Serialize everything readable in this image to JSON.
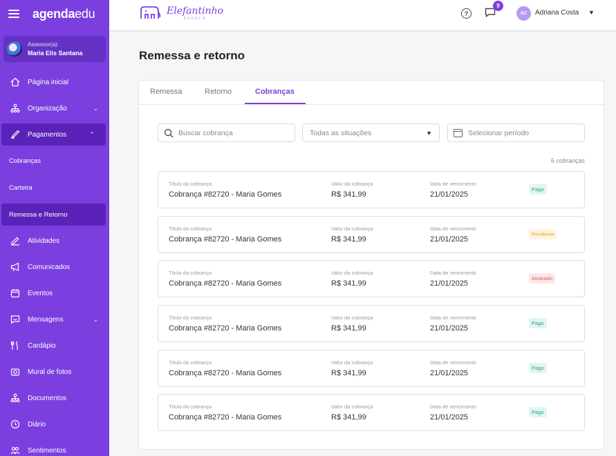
{
  "sidebar": {
    "brand_bold": "agenda",
    "brand_light": "edu",
    "assessor": {
      "role": "Assessor(a):",
      "name": "Maria Elis Santana"
    },
    "items": {
      "home": "Página inicial",
      "org": "Organização",
      "payments": "Pagamentos",
      "charges": "Cobranças",
      "wallet": "Carteira",
      "remittance": "Remessa e Retorno",
      "activities": "Atividades",
      "announcements": "Comunicados",
      "events": "Eventos",
      "messages": "Mensagens",
      "menu": "Cardápio",
      "photos": "Mural de fotos",
      "documents": "Documentos",
      "diary": "Diário",
      "feelings": "Sentimentos"
    }
  },
  "topbar": {
    "logo_text": "Elefantinho",
    "logo_sub": "ESCOLA",
    "notification_count": "9",
    "user_initials": "AC",
    "user_name": "Adriana Costa"
  },
  "page": {
    "title": "Remessa e retorno"
  },
  "tabs": {
    "remessa": "Remessa",
    "retorno": "Retorno",
    "cobrancas": "Cobranças"
  },
  "filters": {
    "search_placeholder": "Buscar cobrança",
    "status_value": "Todas as situações",
    "period_placeholder": "Selecionar período"
  },
  "count": "6 cobranças",
  "labels": {
    "title": "Título da cobrança",
    "value": "Valor da cobrança",
    "due": "Data de vencimento"
  },
  "rows": [
    {
      "title": "Cobrança #82720 - Maria Gomes",
      "value": "R$ 341,99",
      "due": "21/01/2025",
      "status": "Pago"
    },
    {
      "title": "Cobrança #82720 - Maria Gomes",
      "value": "R$ 341,99",
      "due": "21/01/2025",
      "status": "Pendente"
    },
    {
      "title": "Cobrança #82720 - Maria Gomes",
      "value": "R$ 341,99",
      "due": "21/01/2025",
      "status": "Atrasado"
    },
    {
      "title": "Cobrança #82720 - Maria Gomes",
      "value": "R$ 341,99",
      "due": "21/01/2025",
      "status": "Pago"
    },
    {
      "title": "Cobrança #82720 - Maria Gomes",
      "value": "R$ 341,99",
      "due": "21/01/2025",
      "status": "Pago"
    },
    {
      "title": "Cobrança #82720 - Maria Gomes",
      "value": "R$ 341,99",
      "due": "21/01/2025",
      "status": "Pago"
    }
  ],
  "colors": {
    "accent": "#7b3fe0",
    "sidebar_active": "#5a22b8",
    "pago": "#2a9c86",
    "pendente": "#e5a53a",
    "atrasado": "#e05d5d"
  }
}
